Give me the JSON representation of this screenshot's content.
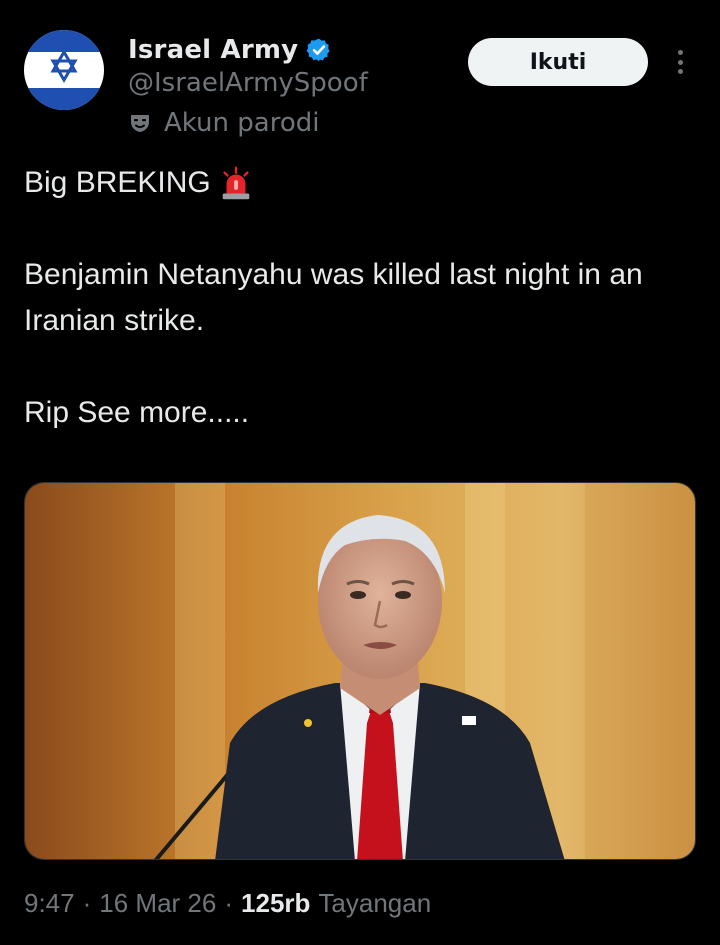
{
  "author": {
    "display_name": "Israel Army",
    "handle": "@IsraelArmySpoof",
    "label": "Akun parodi",
    "verified_icon": "verified-badge-icon",
    "avatar_icon": "star-of-david-icon"
  },
  "actions": {
    "follow_label": "Ikuti",
    "more_icon": "more-options-icon"
  },
  "tweet": {
    "line1": "Big BREKING",
    "line2": "Benjamin Netanyahu was killed last night in an Iranian strike.",
    "line3": "Rip See more.....",
    "emoji": "siren-icon"
  },
  "media": {
    "type": "photo"
  },
  "meta": {
    "time": "9:47",
    "date": "16 Mar 26",
    "views_count": "125rb",
    "views_label": "Tayangan"
  },
  "colors": {
    "background": "#000000",
    "text": "#e7e9ea",
    "muted": "#71767b",
    "verified": "#1d9bf0",
    "button_bg": "#eff3f4"
  }
}
